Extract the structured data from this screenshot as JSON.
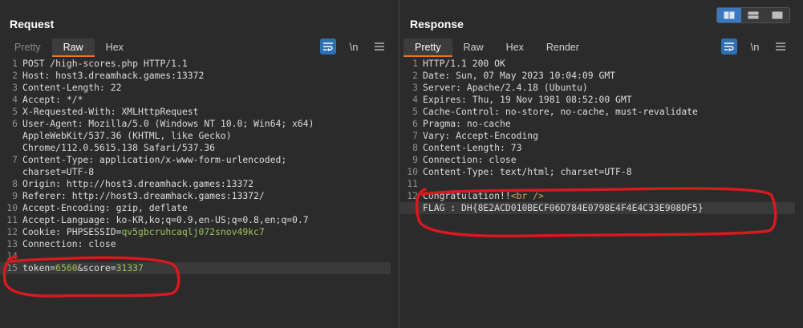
{
  "request": {
    "title": "Request",
    "tabs": [
      {
        "label": "Pretty",
        "state": "dim"
      },
      {
        "label": "Raw",
        "state": "active"
      },
      {
        "label": "Hex",
        "state": "normal"
      }
    ],
    "tools": {
      "wrap_icon": "wrap-lines-icon",
      "newline_label": "\\n",
      "menu_icon": "menu-icon"
    },
    "lines": [
      {
        "n": "1",
        "text": "POST /high-scores.php HTTP/1.1"
      },
      {
        "n": "2",
        "key": "Host",
        "value": "host3.dreamhack.games:13372"
      },
      {
        "n": "3",
        "key": "Content-Length",
        "value": "22"
      },
      {
        "n": "4",
        "key": "Accept",
        "value": "*/*"
      },
      {
        "n": "5",
        "key": "X-Requested-With",
        "value": "XMLHttpRequest"
      },
      {
        "n": "6",
        "key": "User-Agent",
        "value": "Mozilla/5.0 (Windows NT 10.0; Win64; x64)"
      },
      {
        "n": "",
        "text": "AppleWebKit/537.36 (KHTML, like Gecko)"
      },
      {
        "n": "",
        "text": "Chrome/112.0.5615.138 Safari/537.36"
      },
      {
        "n": "7",
        "key": "Content-Type",
        "value": "application/x-www-form-urlencoded;"
      },
      {
        "n": "",
        "text": "charset=UTF-8"
      },
      {
        "n": "8",
        "key": "Origin",
        "value": "http://host3.dreamhack.games:13372"
      },
      {
        "n": "9",
        "key": "Referer",
        "value": "http://host3.dreamhack.games:13372/"
      },
      {
        "n": "10",
        "key": "Accept-Encoding",
        "value": "gzip, deflate"
      },
      {
        "n": "11",
        "key": "Accept-Language",
        "value": "ko-KR,ko;q=0.9,en-US;q=0.8,en;q=0.7"
      },
      {
        "n": "12",
        "key": "Cookie",
        "cookie_name": "PHPSESSID",
        "cookie_value": "qv5gbcruhcaqlj072snov49kc7"
      },
      {
        "n": "13",
        "key": "Connection",
        "value": "close"
      },
      {
        "n": "14",
        "text": ""
      },
      {
        "n": "15",
        "body": [
          {
            "k": "token",
            "v": "6560"
          },
          {
            "k": "score",
            "v": "31337"
          }
        ]
      }
    ]
  },
  "response": {
    "title": "Response",
    "tabs": [
      {
        "label": "Pretty",
        "state": "active"
      },
      {
        "label": "Raw",
        "state": "normal"
      },
      {
        "label": "Hex",
        "state": "normal"
      },
      {
        "label": "Render",
        "state": "normal"
      }
    ],
    "tools": {
      "wrap_icon": "wrap-lines-icon",
      "newline_label": "\\n",
      "menu_icon": "menu-icon"
    },
    "lines": [
      {
        "n": "1",
        "text": "HTTP/1.1 200 OK"
      },
      {
        "n": "2",
        "key": "Date",
        "value": "Sun, 07 May 2023 10:04:09 GMT"
      },
      {
        "n": "3",
        "key": "Server",
        "value": "Apache/2.4.18 (Ubuntu)"
      },
      {
        "n": "4",
        "key": "Expires",
        "value": "Thu, 19 Nov 1981 08:52:00 GMT"
      },
      {
        "n": "5",
        "key": "Cache-Control",
        "value": "no-store, no-cache, must-revalidate"
      },
      {
        "n": "6",
        "key": "Pragma",
        "value": "no-cache"
      },
      {
        "n": "7",
        "key": "Vary",
        "value": "Accept-Encoding"
      },
      {
        "n": "8",
        "key": "Content-Length",
        "value": "73"
      },
      {
        "n": "9",
        "key": "Connection",
        "value": "close"
      },
      {
        "n": "10",
        "key": "Content-Type",
        "value": "text/html; charset=UTF-8"
      },
      {
        "n": "11",
        "text": ""
      },
      {
        "n": "12",
        "body_text": "Congratulation!!",
        "body_tag": "<br />"
      },
      {
        "n": "",
        "text": "FLAG : DH{8E2ACD010BECF06D784E0798E4F4E4C33E908DF5}"
      }
    ]
  },
  "layout_switch": {
    "options": [
      "side-by-side-icon",
      "stacked-icon",
      "single-pane-icon"
    ],
    "active": 0
  },
  "colors": {
    "accent_tab": "#e8742c",
    "toolbar_on": "#2f6fb4",
    "value_green": "#9bc25b",
    "annotation_red": "#d8191f"
  }
}
